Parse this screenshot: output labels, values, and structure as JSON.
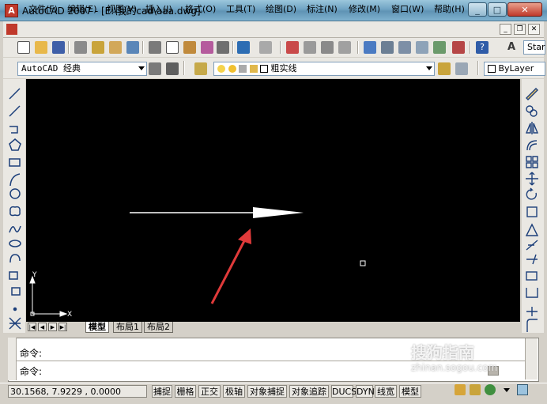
{
  "window": {
    "title": "AutoCAD 2007 - [E:\\我的cad\\aaa.dwg]",
    "app_icon": "A",
    "minimize": "_",
    "maximize": "□",
    "close": "✕"
  },
  "menu": {
    "items": [
      "文件(F)",
      "编辑(E)",
      "视图(V)",
      "插入(I)",
      "格式(O)",
      "工具(T)",
      "绘图(D)",
      "标注(N)",
      "修改(M)",
      "窗口(W)",
      "帮助(H)"
    ],
    "doc_min": "_",
    "doc_restore": "❐",
    "doc_close": "✕"
  },
  "toolbar": {
    "workspace": "AutoCAD 经典",
    "layer": "粗实线",
    "color": "ByLayer",
    "text_style_partial": "Star"
  },
  "canvas": {
    "ucs_x": "X",
    "ucs_y": "Y"
  },
  "layout_tabs": {
    "nav": [
      "|◀",
      "◀",
      "▶",
      "▶|"
    ],
    "tabs": [
      "模型",
      "布局1",
      "布局2"
    ]
  },
  "command": {
    "line1": "命令:",
    "line2": "命令:"
  },
  "status": {
    "coordinates": "30.1568, 7.9229 , 0.0000",
    "buttons": [
      "捕捉",
      "栅格",
      "正交",
      "极轴",
      "对象捕捉",
      "对象追踪",
      "DUCS",
      "DYN",
      "线宽",
      "模型"
    ]
  },
  "watermark": {
    "text": "搜狗指南",
    "url": "zhinan.sogou.com"
  },
  "colors": {
    "canvas": "#000000",
    "arrow_annotation": "#e03a3a",
    "title_bar": "#6fa3c3"
  }
}
